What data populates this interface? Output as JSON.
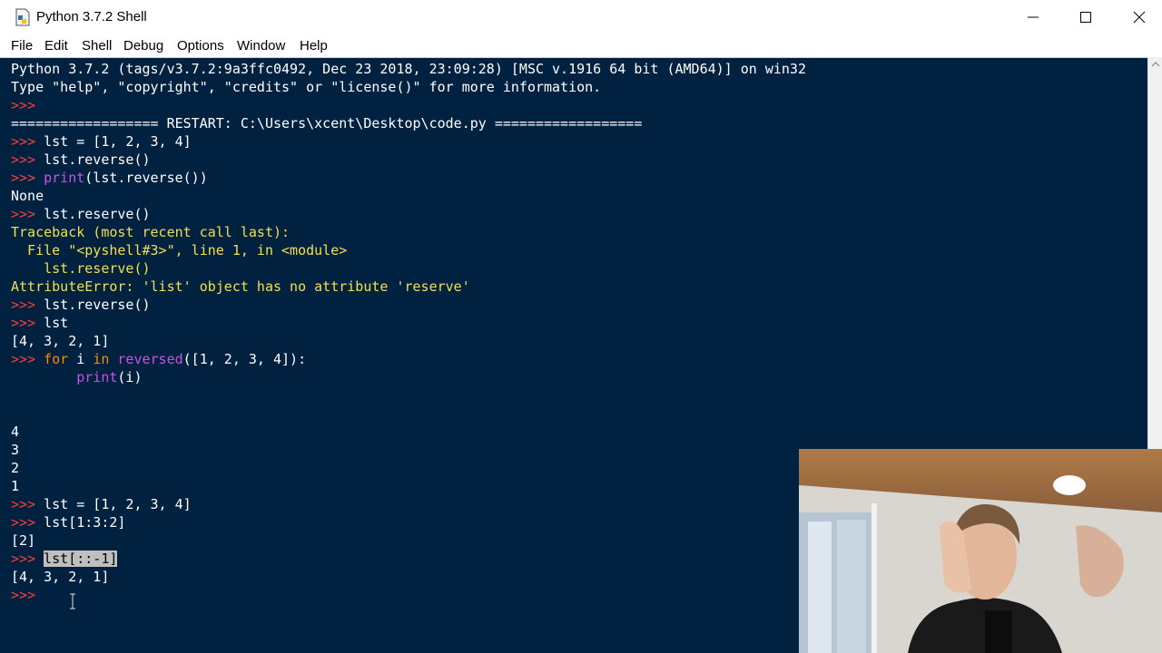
{
  "window": {
    "title": "Python 3.7.2 Shell",
    "icons": [
      "python-file-icon",
      "minimize-icon",
      "maximize-icon",
      "close-icon"
    ]
  },
  "menu": {
    "items": [
      "File",
      "Edit",
      "Shell",
      "Debug",
      "Options",
      "Window",
      "Help"
    ]
  },
  "console": {
    "banner1": "Python 3.7.2 (tags/v3.7.2:9a3ffc0492, Dec 23 2018, 23:09:28) [MSC v.1916 64 bit (AMD64)] on win32",
    "banner2": "Type \"help\", \"copyright\", \"credits\" or \"license()\" for more information.",
    "prompt": ">>> ",
    "restart": "================== RESTART: C:\\Users\\xcent\\Desktop\\code.py ==================",
    "cmd1": "lst = [1, 2, 3, 4]",
    "cmd2": "lst.reverse()",
    "cmd3_fn": "print",
    "cmd3_rest": "(lst.reverse())",
    "out_none": "None",
    "cmd4": "lst.reserve()",
    "tb1": "Traceback (most recent call last):",
    "tb2": "  File \"<pyshell#3>\", line 1, in <module>",
    "tb3": "    lst.reserve()",
    "tb4": "AttributeError: 'list' object has no attribute 'reserve'",
    "cmd5": "lst.reverse()",
    "cmd6": "lst",
    "out_list": "[4, 3, 2, 1]",
    "for_kw": "for",
    "for_i": " i ",
    "in_kw": "in",
    "reversed_fn": "reversed",
    "for_rest": "([1, 2, 3, 4]):",
    "print_indent": "        ",
    "print_fn": "print",
    "print_rest": "(i)",
    "out4": "4",
    "out3": "3",
    "out2": "2",
    "out1": "1",
    "cmd7": "lst = [1, 2, 3, 4]",
    "cmd8": "lst[1:3:2]",
    "out_slice": "[2]",
    "cmd9": "lst[::-1]",
    "out_rev": "[4, 3, 2, 1]",
    "final_prompt": ">>> "
  },
  "colors": {
    "background": "#002240",
    "prompt": "#ff3b3b",
    "keyword": "#ff8a00",
    "builtin": "#d04fe0",
    "error": "#f0e050",
    "text": "#ffffff"
  }
}
